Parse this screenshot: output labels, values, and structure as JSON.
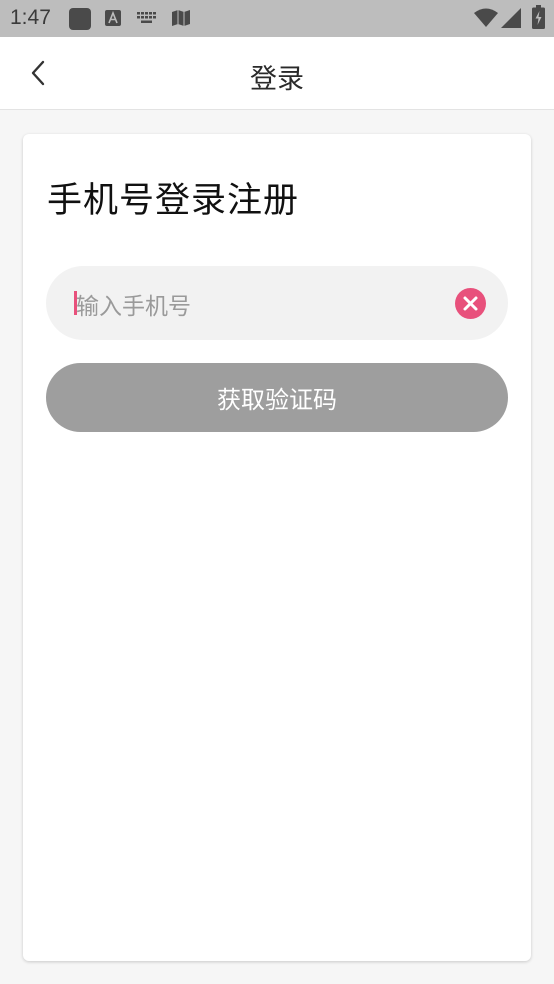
{
  "status_bar": {
    "time": "1:47",
    "left_icons": [
      "app-square-icon",
      "font-a-icon",
      "keyboard-icon",
      "map-icon"
    ],
    "right_icons": [
      "wifi-icon",
      "cell-signal-icon",
      "battery-charging-icon"
    ]
  },
  "header": {
    "back_icon": "chevron-left-icon",
    "title": "登录"
  },
  "card": {
    "title": "手机号登录注册",
    "phone_input": {
      "placeholder": "输入手机号",
      "value": "",
      "clear_icon": "clear-x-icon"
    },
    "get_code_button": "获取验证码"
  },
  "colors": {
    "accent": "#e8517c",
    "button_disabled": "#9e9e9e",
    "input_bg": "#f2f2f2",
    "status_bar_bg": "#bdbdbd"
  }
}
